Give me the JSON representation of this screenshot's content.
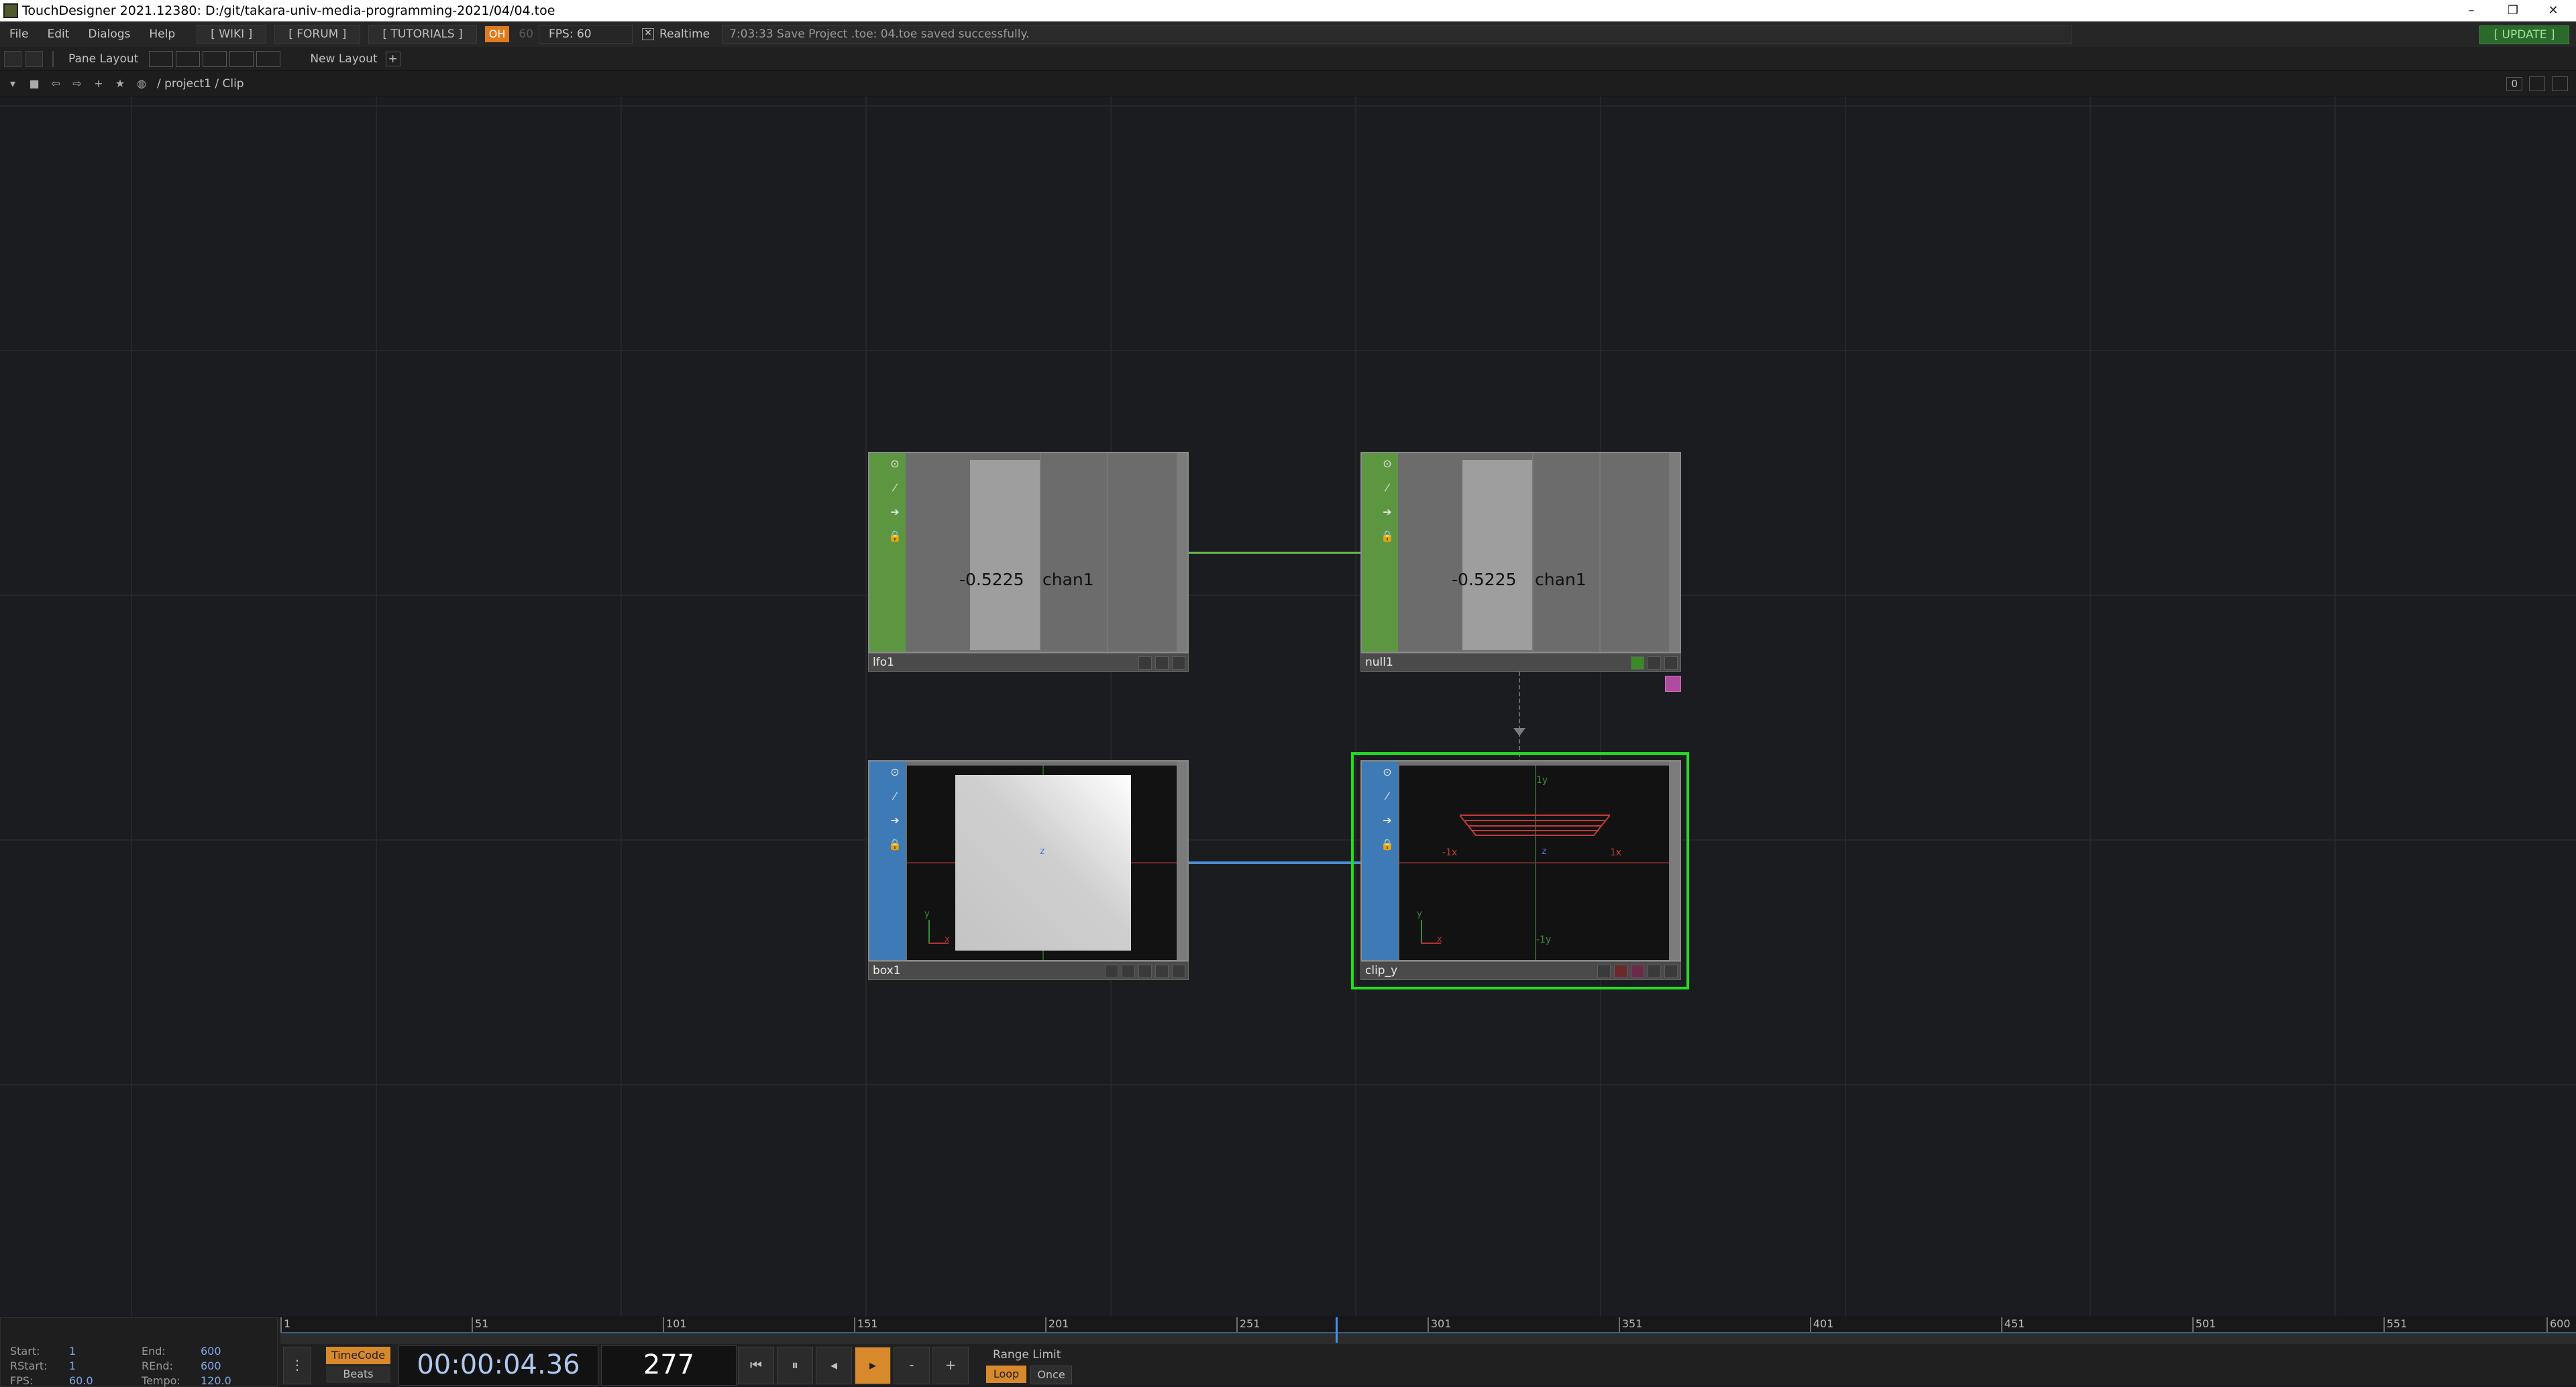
{
  "window": {
    "title": "TouchDesigner 2021.12380: D:/git/takara-univ-media-programming-2021/04/04.toe",
    "min_glyph": "–",
    "restore_glyph": "❐",
    "close_glyph": "✕"
  },
  "menubar": {
    "items": [
      "File",
      "Edit",
      "Dialogs",
      "Help"
    ],
    "wiki": "[ WIKI ]",
    "forum": "[ FORUM ]",
    "tutorials": "[ TUTORIALS ]",
    "oh_badge": "OH",
    "fps_target": "60",
    "fps_label": "FPS:  60",
    "realtime_label": "Realtime",
    "realtime_checked": "✕",
    "status_message": "7:03:33 Save Project .toe: 04.toe saved successfully.",
    "update": "[ UPDATE ]"
  },
  "panebar": {
    "pane_layout": "Pane Layout",
    "new_layout": "New Layout",
    "add": "+"
  },
  "pathbar": {
    "path": "/ project1 / Clip",
    "right_value": "0"
  },
  "nodes": {
    "lfo1": {
      "name": "lfo1",
      "value": "-0.5225",
      "channel": "chan1"
    },
    "null1": {
      "name": "null1",
      "value": "-0.5225",
      "channel": "chan1"
    },
    "box1": {
      "name": "box1",
      "center_label": "z",
      "gizmo_y": "y",
      "gizmo_x": "x"
    },
    "clip_y": {
      "name": "clip_y",
      "plus_y": "1y",
      "minus_y": "-1y",
      "minus_x": "-1x",
      "plus_x": "1x",
      "center_label": "z",
      "gizmo_y": "y",
      "gizmo_x": "x"
    }
  },
  "timeline": {
    "ruler_ticks": [
      "1",
      "51",
      "101",
      "151",
      "201",
      "251",
      "301",
      "351",
      "401",
      "451",
      "501",
      "551",
      "600"
    ],
    "range": {
      "start_label": "Start:",
      "start": "1",
      "end_label": "End:",
      "end": "600",
      "rstart_label": "RStart:",
      "rstart": "1",
      "rend_label": "REnd:",
      "rend": "600",
      "fps_label": "FPS:",
      "fps": "60.0",
      "tempo_label": "Tempo:",
      "tempo": "120.0"
    },
    "timecode_btn": "TimeCode",
    "beats_btn": "Beats",
    "timecode": "00:00:04.36",
    "frame": "277",
    "range_limit": "Range Limit",
    "loop": "Loop",
    "once": "Once",
    "minus": "-",
    "plus": "+",
    "playhead_frame": 277
  },
  "colors": {
    "chop": "#5d9641",
    "sop": "#3e7bb6",
    "selected": "#22dd22",
    "accent": "#e07a1d"
  }
}
